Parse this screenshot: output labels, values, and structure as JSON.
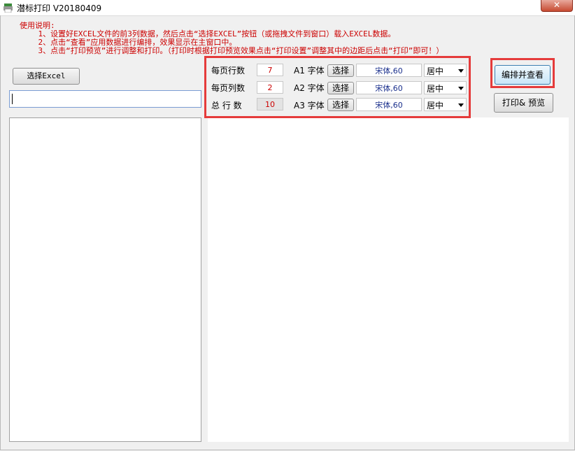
{
  "window": {
    "title": "潜标打印 V20180409",
    "close_label": "✕"
  },
  "instructions": {
    "title": "使用说明:",
    "line1": "1、设置好EXCEL文件的前3列数据，然后点击“选择EXCEL”按钮（或拖拽文件到窗口）载入EXCEL数据。",
    "line2": "2、点击“查看”应用数据进行编排，效果显示在主窗口中。",
    "line3": "3、点击“打印预览”进行调整和打印。（打印时根据打印预览效果点击“打印设置”调整其中的边距后点击“打印”即可！）"
  },
  "toolbar": {
    "select_excel_label": "选择Excel",
    "file_path": ""
  },
  "settings": {
    "rows_per_page_label": "每页行数",
    "rows_per_page": "7",
    "cols_per_page_label": "每页列数",
    "cols_per_page": "2",
    "total_rows_label": "总 行 数",
    "total_rows": "10",
    "fonts": [
      {
        "label": "A1 字体",
        "button": "选择",
        "font": "宋体,60",
        "align": "居中"
      },
      {
        "label": "A2 字体",
        "button": "选择",
        "font": "宋体,60",
        "align": "居中"
      },
      {
        "label": "A3 字体",
        "button": "选择",
        "font": "宋体,60",
        "align": "居中"
      }
    ]
  },
  "actions": {
    "compose_label": "编排并查看",
    "print_label": "打印& 预览"
  },
  "colors": {
    "highlight": "#e53b3b",
    "instruction_text": "#cc0000",
    "font_text": "#1a2f8c"
  }
}
